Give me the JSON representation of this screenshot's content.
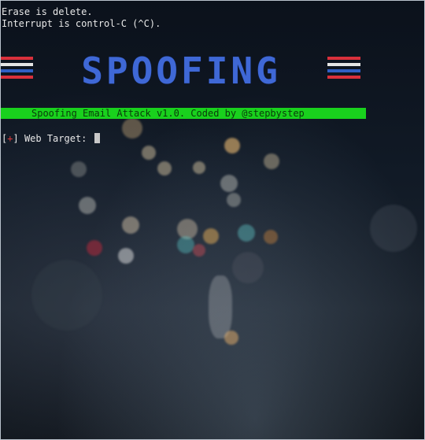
{
  "terminal": {
    "line1": "Erase is delete.",
    "line2": "Interrupt is control-C (^C)."
  },
  "banner": {
    "word": "SPOOFING",
    "stripe_colors": [
      "#d9303b",
      "#e5e5e5",
      "#2f5fc4",
      "#d9303b"
    ],
    "word_color": "#3f68d6"
  },
  "status_bar": {
    "text": "Spoofing Email Attack v1.0. Coded by @stepbystep",
    "color": "#19d11d"
  },
  "prompt": {
    "bracket_open": "[",
    "symbol": "+",
    "bracket_close": "]",
    "label": "Web Target:",
    "input_value": ""
  }
}
